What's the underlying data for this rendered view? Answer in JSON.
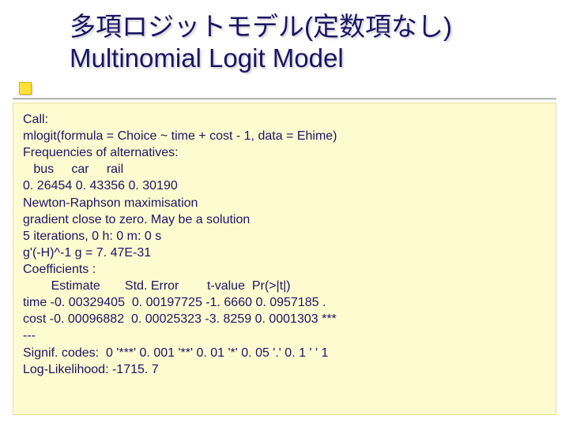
{
  "title": {
    "jp": "多項ロジットモデル(定数項なし)",
    "en": "Multinomial Logit Model"
  },
  "output": {
    "call_label": "Call:",
    "call": "mlogit(formula = Choice ~ time + cost - 1, data = Ehime)",
    "freq_label": "Frequencies of alternatives:",
    "freq_header": "   bus     car     rail",
    "freq_values": "0. 26454 0. 43356 0. 30190",
    "optim": "Newton-Raphson maximisation",
    "grad": "gradient close to zero. May be a solution",
    "iters": "5 iterations, 0 h: 0 m: 0 s",
    "gprime": "g'(-H)^-1 g = 7. 47E-31",
    "coef_label": "Coefficients :",
    "coef_header": "        Estimate       Std. Error        t-value  Pr(>|t|)",
    "coef_time": "time -0. 00329405  0. 00197725 -1. 6660 0. 0957185 .",
    "coef_cost": "cost -0. 00096882  0. 00025323 -3. 8259 0. 0001303 ***",
    "dash": "---",
    "signif": "Signif. codes:  0 '***' 0. 001 '**' 0. 01 '*' 0. 05 '.' 0. 1 ' ' 1",
    "loglik": "Log-Likelihood: -1715. 7"
  }
}
